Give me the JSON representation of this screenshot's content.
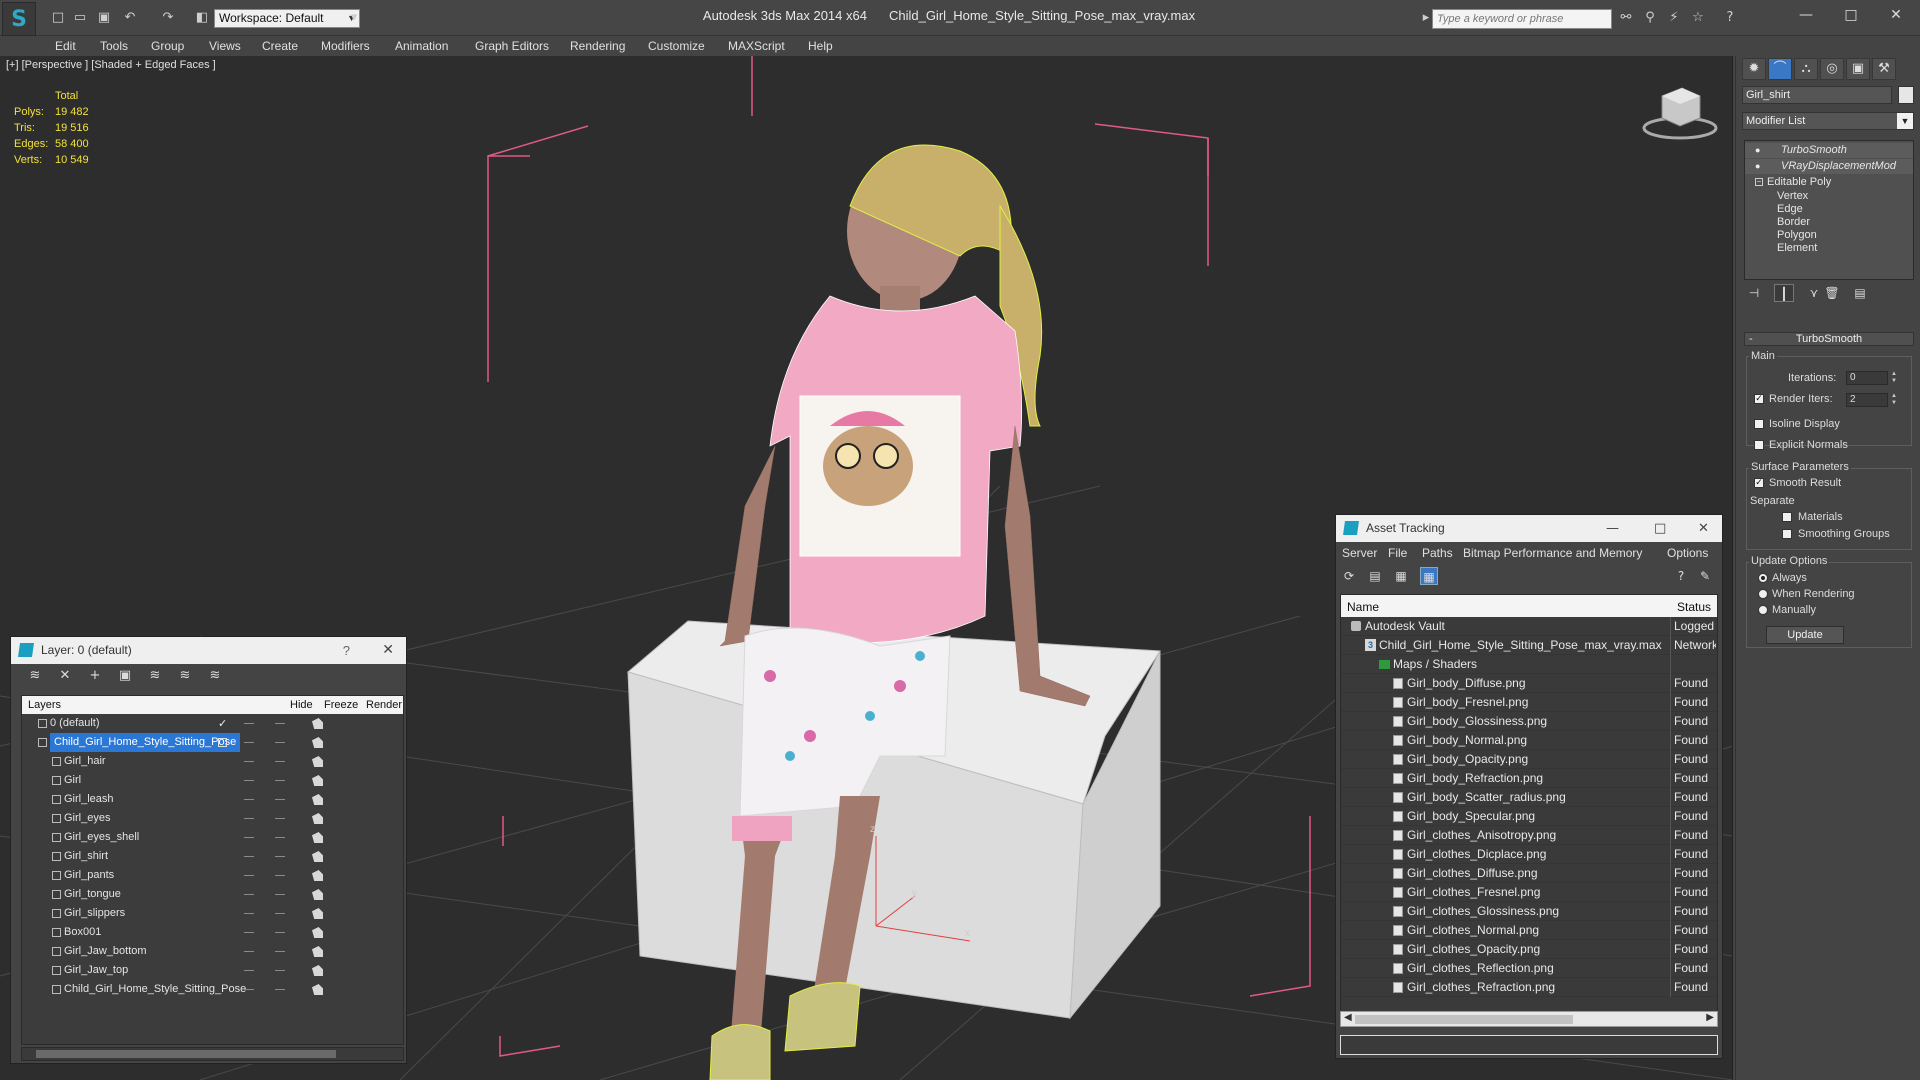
{
  "titlebar": {
    "app_title": "Autodesk 3ds Max  2014 x64",
    "file_title": "Child_Girl_Home_Style_Sitting_Pose_max_vray.max",
    "workspace_label": "Workspace: Default",
    "search_placeholder": "Type a keyword or phrase"
  },
  "menu": [
    "Edit",
    "Tools",
    "Group",
    "Views",
    "Create",
    "Modifiers",
    "Animation",
    "Graph Editors",
    "Rendering",
    "Customize",
    "MAXScript",
    "Help"
  ],
  "viewport": {
    "label": "[+] [Perspective ] [Shaded + Edged Faces ]",
    "stats_header": "Total",
    "stats": [
      {
        "label": "Polys:",
        "value": "19 482"
      },
      {
        "label": "Tris:",
        "value": "19 516"
      },
      {
        "label": "Edges:",
        "value": "58 400"
      },
      {
        "label": "Verts:",
        "value": "10 549"
      }
    ],
    "stats_color": "#f2e13a",
    "gizmo_labels": {
      "z": "z",
      "y": "y",
      "x": "x"
    }
  },
  "command_panel": {
    "object_name": "Girl_shirt",
    "modifier_list": "Modifier List",
    "stack": {
      "modifiers": [
        "TurboSmooth",
        "VRayDisplacementMod"
      ],
      "base": "Editable Poly",
      "subobjects": [
        "Vertex",
        "Edge",
        "Border",
        "Polygon",
        "Element"
      ]
    },
    "rollout": {
      "title": "TurboSmooth",
      "main_group": "Main",
      "iterations_label": "Iterations:",
      "iterations_value": "0",
      "render_iters_label": "Render Iters:",
      "render_iters_value": "2",
      "isoline_label": "Isoline Display",
      "explicit_normals_label": "Explicit Normals",
      "surface_group": "Surface Parameters",
      "smooth_result_label": "Smooth Result",
      "separate_label": "Separate",
      "materials_label": "Materials",
      "smoothing_groups_label": "Smoothing Groups",
      "update_group": "Update Options",
      "update_options": [
        "Always",
        "When Rendering",
        "Manually"
      ],
      "update_button": "Update"
    }
  },
  "layer_window": {
    "title": "Layer: 0 (default)",
    "help": "?",
    "columns": [
      "Layers",
      "Hide",
      "Freeze",
      "Render"
    ],
    "rows": [
      {
        "name": "0 (default)",
        "indent": 0,
        "checked": true
      },
      {
        "name": "Child_Girl_Home_Style_Sitting_Pose",
        "indent": 0,
        "selected": true
      },
      {
        "name": "Girl_hair",
        "indent": 1
      },
      {
        "name": "Girl",
        "indent": 1
      },
      {
        "name": "Girl_leash",
        "indent": 1
      },
      {
        "name": "Girl_eyes",
        "indent": 1
      },
      {
        "name": "Girl_eyes_shell",
        "indent": 1
      },
      {
        "name": "Girl_shirt",
        "indent": 1
      },
      {
        "name": "Girl_pants",
        "indent": 1
      },
      {
        "name": "Girl_tongue",
        "indent": 1
      },
      {
        "name": "Girl_slippers",
        "indent": 1
      },
      {
        "name": "Box001",
        "indent": 1
      },
      {
        "name": "Girl_Jaw_bottom",
        "indent": 1
      },
      {
        "name": "Girl_Jaw_top",
        "indent": 1
      },
      {
        "name": "Child_Girl_Home_Style_Sitting_Pose",
        "indent": 1
      }
    ]
  },
  "asset_window": {
    "title": "Asset Tracking",
    "menu": [
      "Server",
      "File",
      "Paths",
      "Bitmap Performance and Memory",
      "Options"
    ],
    "columns": [
      "Name",
      "Status"
    ],
    "rows": [
      {
        "name": "Autodesk Vault",
        "status": "Logged O",
        "kind": "vault",
        "indent": 0
      },
      {
        "name": "Child_Girl_Home_Style_Sitting_Pose_max_vray.max",
        "status": "Network",
        "kind": "max",
        "indent": 1
      },
      {
        "name": "Maps / Shaders",
        "status": "",
        "kind": "folder",
        "indent": 2
      },
      {
        "name": "Girl_body_Diffuse.png",
        "status": "Found",
        "kind": "file",
        "indent": 3
      },
      {
        "name": "Girl_body_Fresnel.png",
        "status": "Found",
        "kind": "file",
        "indent": 3
      },
      {
        "name": "Girl_body_Glossiness.png",
        "status": "Found",
        "kind": "file",
        "indent": 3
      },
      {
        "name": "Girl_body_Normal.png",
        "status": "Found",
        "kind": "file",
        "indent": 3
      },
      {
        "name": "Girl_body_Opacity.png",
        "status": "Found",
        "kind": "file",
        "indent": 3
      },
      {
        "name": "Girl_body_Refraction.png",
        "status": "Found",
        "kind": "file",
        "indent": 3
      },
      {
        "name": "Girl_body_Scatter_radius.png",
        "status": "Found",
        "kind": "file",
        "indent": 3
      },
      {
        "name": "Girl_body_Specular.png",
        "status": "Found",
        "kind": "file",
        "indent": 3
      },
      {
        "name": "Girl_clothes_Anisotropy.png",
        "status": "Found",
        "kind": "file",
        "indent": 3
      },
      {
        "name": "Girl_clothes_Dicplace.png",
        "status": "Found",
        "kind": "file",
        "indent": 3
      },
      {
        "name": "Girl_clothes_Diffuse.png",
        "status": "Found",
        "kind": "file",
        "indent": 3
      },
      {
        "name": "Girl_clothes_Fresnel.png",
        "status": "Found",
        "kind": "file",
        "indent": 3
      },
      {
        "name": "Girl_clothes_Glossiness.png",
        "status": "Found",
        "kind": "file",
        "indent": 3
      },
      {
        "name": "Girl_clothes_Normal.png",
        "status": "Found",
        "kind": "file",
        "indent": 3
      },
      {
        "name": "Girl_clothes_Opacity.png",
        "status": "Found",
        "kind": "file",
        "indent": 3
      },
      {
        "name": "Girl_clothes_Reflection.png",
        "status": "Found",
        "kind": "file",
        "indent": 3
      },
      {
        "name": "Girl_clothes_Refraction.png",
        "status": "Found",
        "kind": "file",
        "indent": 3
      }
    ]
  },
  "colors": {
    "accent": "#2b77d6",
    "viewport_bg": "#2d2d2d",
    "bounding_box": "#e05a8a",
    "wireframe_highlight": "#e0f040"
  }
}
